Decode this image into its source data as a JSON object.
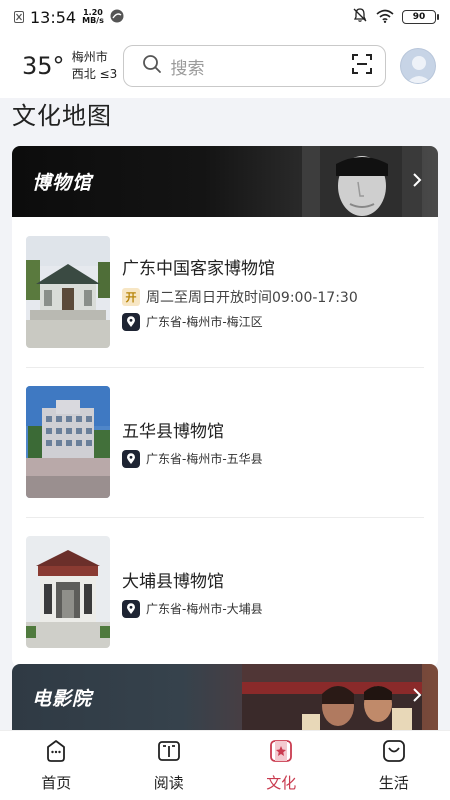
{
  "status_bar": {
    "time": "13:54",
    "net_speed_value": "1.20",
    "net_speed_unit": "MB/s",
    "battery": "90"
  },
  "header": {
    "temperature": "35°",
    "city": "梅州市",
    "wind": "西北 ≤3",
    "search_placeholder": "搜索"
  },
  "page": {
    "section_title": "文化地图"
  },
  "museums": {
    "banner_title": "博物馆",
    "items": [
      {
        "name": "广东中国客家博物馆",
        "open_badge": "开",
        "hours": "周二至周日开放时间09:00-17:30",
        "address": "广东省-梅州市-梅江区"
      },
      {
        "name": "五华县博物馆",
        "address": "广东省-梅州市-五华县"
      },
      {
        "name": "大埔县博物馆",
        "address": "广东省-梅州市-大埔县"
      }
    ]
  },
  "cinemas": {
    "banner_title": "电影院"
  },
  "bottom_nav": {
    "items": [
      {
        "label": "首页",
        "icon": "home-icon"
      },
      {
        "label": "阅读",
        "icon": "book-icon"
      },
      {
        "label": "文化",
        "icon": "culture-icon"
      },
      {
        "label": "生活",
        "icon": "life-icon"
      }
    ],
    "active_index": 2,
    "active_color": "#c93b4f"
  }
}
